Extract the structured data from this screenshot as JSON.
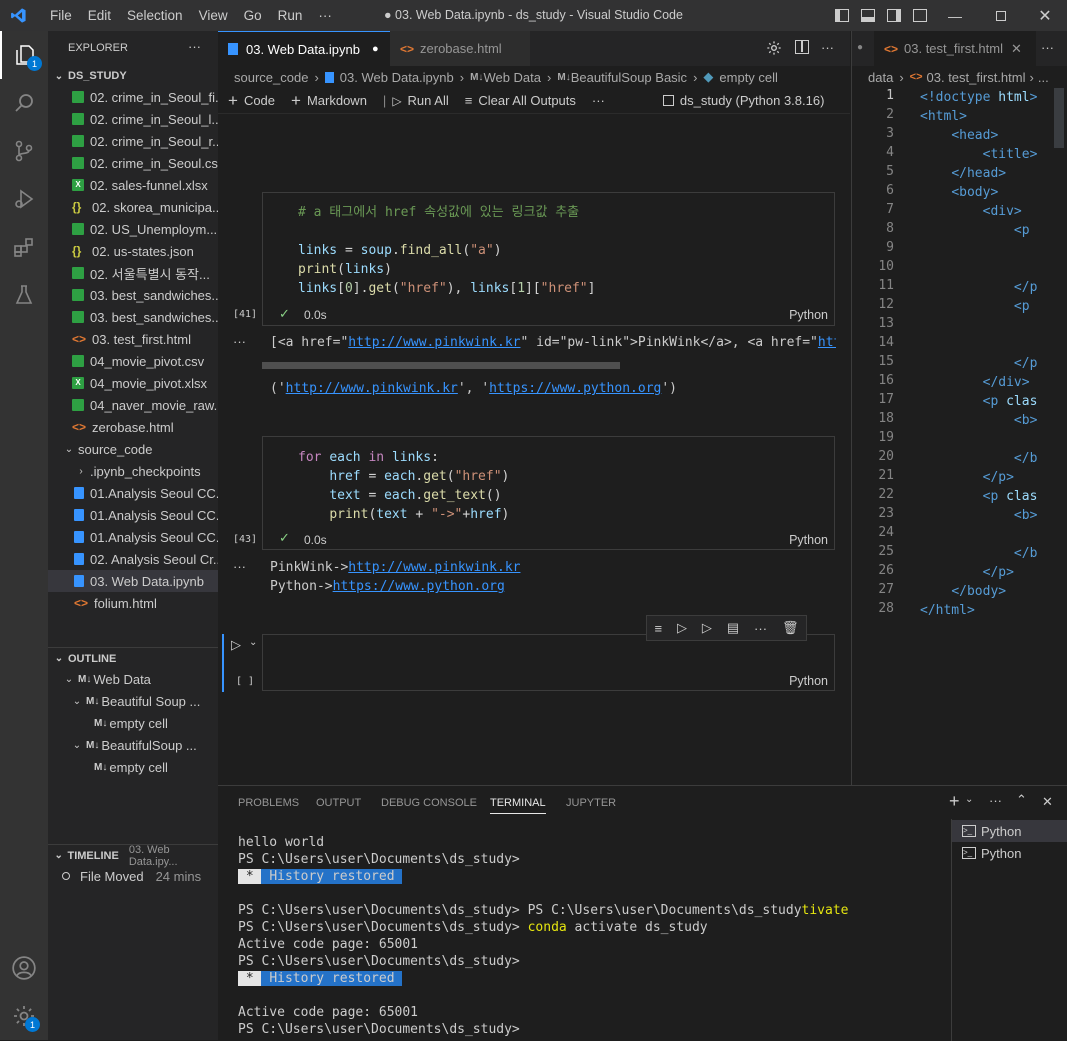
{
  "titlebar": {
    "menu": [
      "File",
      "Edit",
      "Selection",
      "View",
      "Go",
      "Run",
      "···"
    ],
    "title": "● 03. Web Data.ipynb - ds_study - Visual Studio Code"
  },
  "activity": {
    "explorer_badge": "1",
    "settings_badge": "1"
  },
  "explorer": {
    "header": "EXPLORER",
    "root": "DS_STUDY",
    "files": [
      {
        "name": "02. crime_in_Seoul_fi...",
        "type": "csv"
      },
      {
        "name": "02. crime_in_Seoul_l...",
        "type": "csv"
      },
      {
        "name": "02. crime_in_Seoul_r...",
        "type": "csv"
      },
      {
        "name": "02. crime_in_Seoul.csv",
        "type": "csv"
      },
      {
        "name": "02. sales-funnel.xlsx",
        "type": "xlsx"
      },
      {
        "name": "02. skorea_municipa...",
        "type": "json"
      },
      {
        "name": "02. US_Unemploym...",
        "type": "csv"
      },
      {
        "name": "02. us-states.json",
        "type": "json"
      },
      {
        "name": "02. 서울특별시 동작...",
        "type": "csv"
      },
      {
        "name": "03. best_sandwiches...",
        "type": "csv"
      },
      {
        "name": "03. best_sandwiches...",
        "type": "csv"
      },
      {
        "name": "03. test_first.html",
        "type": "html"
      },
      {
        "name": "04_movie_pivot.csv",
        "type": "csv"
      },
      {
        "name": "04_movie_pivot.xlsx",
        "type": "xlsx"
      },
      {
        "name": "04_naver_movie_raw...",
        "type": "csv"
      },
      {
        "name": "zerobase.html",
        "type": "html"
      }
    ],
    "folder": "source_code",
    "folder_items": [
      {
        "name": ".ipynb_checkpoints",
        "type": "folder"
      },
      {
        "name": "01.Analysis Seoul CC...",
        "type": "nb"
      },
      {
        "name": "01.Analysis Seoul CC...",
        "type": "nb"
      },
      {
        "name": "01.Analysis Seoul CC...",
        "type": "nb"
      },
      {
        "name": "02. Analysis Seoul Cr...",
        "type": "nb"
      },
      {
        "name": "03. Web Data.ipynb",
        "type": "nb"
      },
      {
        "name": "folium.html",
        "type": "html"
      }
    ]
  },
  "outline": {
    "header": "OUTLINE",
    "items": [
      "Web Data",
      "Beautiful Soup ...",
      "empty cell",
      "BeautifulSoup ...",
      "empty cell"
    ]
  },
  "timeline": {
    "header": "TIMELINE",
    "file": "03. Web Data.ipy...",
    "entry": "File Moved",
    "time": "24 mins"
  },
  "editor": {
    "tab_active": "03. Web Data.ipynb",
    "tab_other": "zerobase.html",
    "breadcrumb": [
      "source_code",
      "03. Web Data.ipynb",
      "Web Data",
      "BeautifulSoup Basic",
      "empty cell"
    ],
    "toolbar": {
      "code": "Code",
      "markdown": "Markdown",
      "run_all": "Run All",
      "clear": "Clear All Outputs",
      "more": "···",
      "kernel": "ds_study (Python 3.8.16)"
    },
    "cell1": {
      "comment": "# a 태그에서 href 속성값에 있는 링크값 추출",
      "exec_count": "[41]",
      "time": "0.0s",
      "lang": "Python",
      "output1_pre": "[<a href=\"",
      "output1_link": "http://www.pinkwink.kr",
      "output1_mid": "\" id=\"pw-link\">PinkWink</a>, <a href=\"",
      "output1_link2": "http",
      "output2_a": "('",
      "output2_l1": "http://www.pinkwink.kr",
      "output2_b": "', '",
      "output2_l2": "https://www.python.org",
      "output2_c": "')"
    },
    "cell2": {
      "exec_count": "[43]",
      "time": "0.0s",
      "lang": "Python",
      "out1_pre": "PinkWink->",
      "out1_link": "http://www.pinkwink.kr",
      "out2_pre": "Python->",
      "out2_link": "https://www.python.org"
    },
    "cell3": {
      "exec_count": "[ ]",
      "lang": "Python"
    }
  },
  "right_editor": {
    "tab": "03. test_first.html",
    "breadcrumb": [
      "data",
      "03. test_first.html",
      "..."
    ]
  },
  "panel": {
    "tabs": [
      "PROBLEMS",
      "OUTPUT",
      "DEBUG CONSOLE",
      "TERMINAL",
      "JUPYTER"
    ],
    "terminals": [
      "Python",
      "Python"
    ],
    "lines": {
      "l1": "hello world",
      "l2": "PS C:\\Users\\user\\Documents\\ds_study>",
      "hist": "History restored",
      "l4a": "PS C:\\Users\\user\\Documents\\ds_study> PS C:\\Users\\user\\Documents\\ds_study",
      "l4b": "tivate",
      "l5a": "PS C:\\Users\\user\\Documents\\ds_study> ",
      "l5b": "conda",
      "l5c": " activate ds_study",
      "l6": "Active code page: 65001",
      "l7": "PS C:\\Users\\user\\Documents\\ds_study>",
      "l9": "Active code page: 65001",
      "l10": "PS C:\\Users\\user\\Documents\\ds_study>"
    }
  }
}
